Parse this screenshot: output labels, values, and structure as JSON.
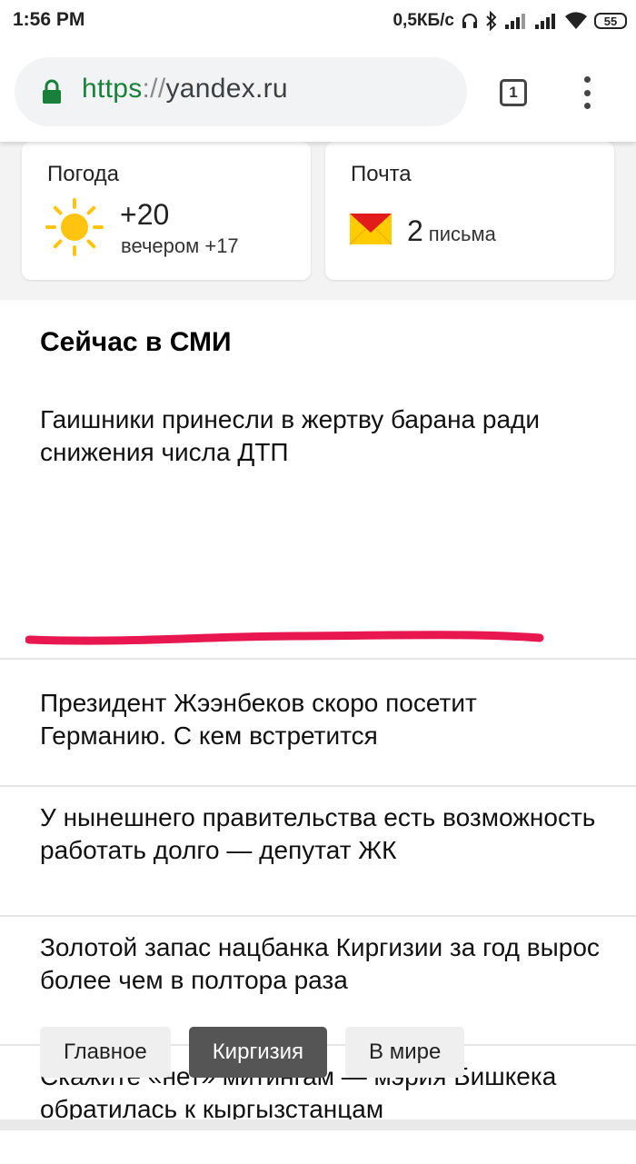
{
  "status_bar": {
    "time": "1:56 PM",
    "net_speed": "0,5КБ/с",
    "battery": "55",
    "icons": [
      "headphones-icon",
      "bluetooth-icon",
      "signal-icon",
      "signal-icon",
      "wifi-icon",
      "battery-icon"
    ]
  },
  "browser": {
    "url_scheme": "https",
    "url_sep": "://",
    "url_host": "yandex.ru",
    "tab_count": "1"
  },
  "widgets": {
    "weather": {
      "title": "Погода",
      "temp": "+20",
      "evening": "вечером +17",
      "icon": "sun-icon"
    },
    "mail": {
      "title": "Почта",
      "count": "2",
      "unit": "письма",
      "icon": "envelope-icon"
    }
  },
  "news": {
    "heading": "Сейчас в СМИ",
    "items": [
      {
        "text": "Гаишники принесли в жертву барана ради снижения числа ДТП"
      },
      {
        "text": "Президент Жээнбеков скоро посетит Германию. С кем встретится"
      },
      {
        "text": "У нынешнего правительства есть возможность работать долго — депутат ЖК"
      },
      {
        "text": "Золотой запас нацбанка Киргизии за год вырос более чем в полтора раза"
      },
      {
        "text": "Скажите «нет» митингам — мэрия Бишкека обратилась к кыргызстанцам"
      }
    ],
    "chips": [
      {
        "label": "Главное",
        "active": false
      },
      {
        "label": "Киргизия",
        "active": true
      },
      {
        "label": "В мире",
        "active": false
      }
    ]
  },
  "colors": {
    "secure_green": "#188038",
    "underline_red": "#e8174f",
    "mail_yellow": "#ffcc00",
    "mail_red": "#e21b1b",
    "active_chip": "#555555"
  }
}
